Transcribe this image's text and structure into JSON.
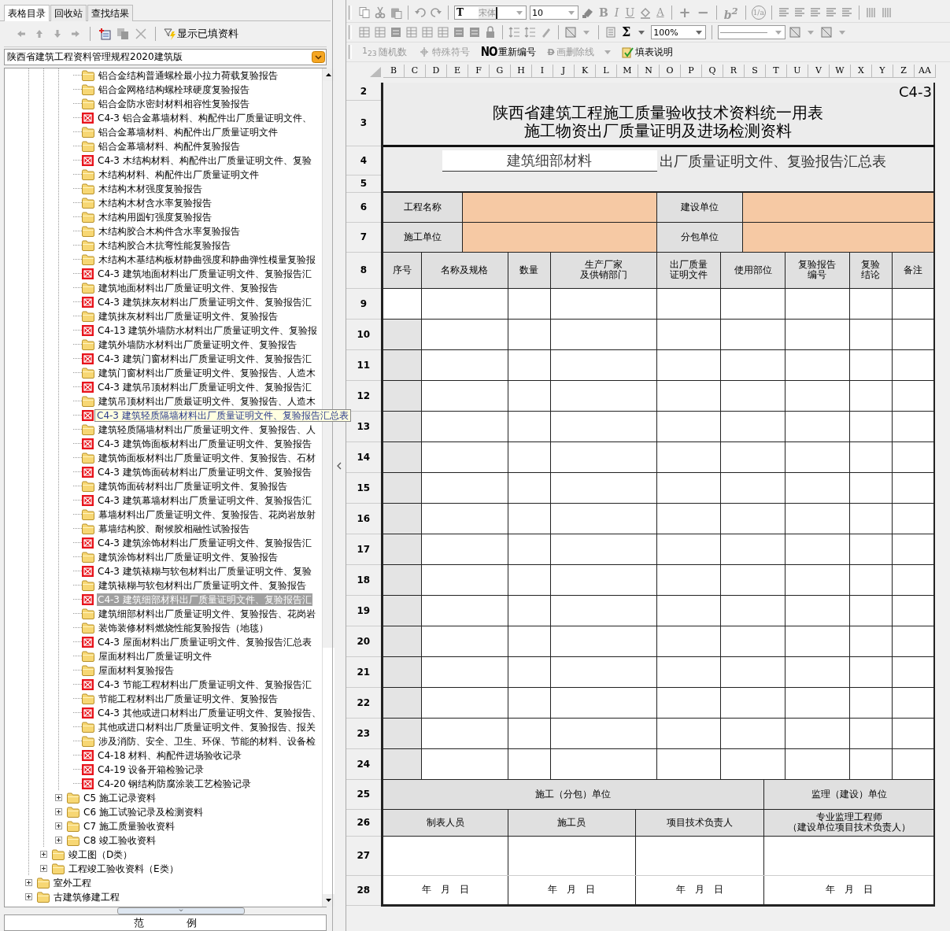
{
  "left_tabs": [
    {
      "label": "表格目录",
      "selected": true
    },
    {
      "label": "回收站",
      "selected": false
    },
    {
      "label": "查找结果",
      "selected": false
    }
  ],
  "left_toolbar": {
    "show_filled_button": "显示已填资料"
  },
  "spec_select": {
    "value": "陕西省建筑工程资料管理规程2020建筑版"
  },
  "tree": [
    {
      "children": [
        {
          "children": [
            {
              "children": [
                {
                  "label": "铝合金结构普通螺栓最小拉力荷载复验报告",
                  "kind": "folder",
                  "selected": false
                },
                {
                  "label": "铝合金网格结构螺栓球硬度复验报告",
                  "kind": "folder",
                  "selected": false
                },
                {
                  "label": "铝合金防水密封材料相容性复验报告",
                  "kind": "folder",
                  "selected": false
                },
                {
                  "label": "C4-3 铝合金幕墙材料、构配件出厂质量证明文件、",
                  "kind": "form",
                  "selected": false
                },
                {
                  "label": "铝合金幕墙材料、构配件出厂质量证明文件",
                  "kind": "folder",
                  "selected": false
                },
                {
                  "label": "铝合金幕墙材料、构配件复验报告",
                  "kind": "folder",
                  "selected": false
                },
                {
                  "label": "C4-3 木结构材料、构配件出厂质量证明文件、复验",
                  "kind": "form",
                  "selected": false
                },
                {
                  "label": "木结构材料、构配件出厂质量证明文件",
                  "kind": "folder",
                  "selected": false
                },
                {
                  "label": "木结构木材强度复验报告",
                  "kind": "folder",
                  "selected": false
                },
                {
                  "label": "木结构木材含水率复验报告",
                  "kind": "folder",
                  "selected": false
                },
                {
                  "label": "木结构用圆钉强度复验报告",
                  "kind": "folder",
                  "selected": false
                },
                {
                  "label": "木结构胶合木构件含水率复验报告",
                  "kind": "folder",
                  "selected": false
                },
                {
                  "label": "木结构胶合木抗弯性能复验报告",
                  "kind": "folder",
                  "selected": false
                },
                {
                  "label": "木结构木基结构板材静曲强度和静曲弹性模量复验报",
                  "kind": "folder",
                  "selected": false
                },
                {
                  "label": "C4-3 建筑地面材料出厂质量证明文件、复验报告汇",
                  "kind": "form",
                  "selected": false
                },
                {
                  "label": "建筑地面材料出厂质量证明文件、复验报告",
                  "kind": "folder",
                  "selected": false
                },
                {
                  "label": "C4-3 建筑抹灰材料出厂质量证明文件、复验报告汇",
                  "kind": "form",
                  "selected": false
                },
                {
                  "label": "建筑抹灰材料出厂质量证明文件、复验报告",
                  "kind": "folder",
                  "selected": false
                },
                {
                  "label": "C4-13 建筑外墙防水材料出厂质量证明文件、复验报",
                  "kind": "form",
                  "selected": false
                },
                {
                  "label": "建筑外墙防水材料出厂质量证明文件、复验报告",
                  "kind": "folder",
                  "selected": false
                },
                {
                  "label": "C4-3 建筑门窗材料出厂质量证明文件、复验报告汇",
                  "kind": "form",
                  "selected": false
                },
                {
                  "label": "建筑门窗材料出厂质量证明文件、复验报告、人造木",
                  "kind": "folder",
                  "selected": false
                },
                {
                  "label": "C4-3 建筑吊顶材料出厂质量证明文件、复验报告汇",
                  "kind": "form",
                  "selected": false
                },
                {
                  "label": "建筑吊顶材料出厂质最证明文件、复验报告、人造木",
                  "kind": "folder",
                  "selected": false
                },
                {
                  "kind": "form",
                  "selected": false,
                  "tooltip": "C4-3 建筑轻质隔墙材料出厂质量证明文件、复验报告汇总表"
                },
                {
                  "label": "建筑轻质隔墙材料出厂质量证明文件、复验报告、人",
                  "kind": "folder",
                  "selected": false
                },
                {
                  "label": "C4-3 建筑饰面板材料出厂质量证明文件、复验报告",
                  "kind": "form",
                  "selected": false
                },
                {
                  "label": "建筑饰面板材料出厂质量证明文件、复验报告、石材",
                  "kind": "folder",
                  "selected": false
                },
                {
                  "label": "C4-3 建筑饰面砖材料出厂质量证明文件、复验报告",
                  "kind": "form",
                  "selected": false
                },
                {
                  "label": "建筑饰面砖材料出厂质量证明文件、复验报告",
                  "kind": "folder",
                  "selected": false
                },
                {
                  "label": "C4-3 建筑幕墙材料出厂质量证明文件、复验报告汇",
                  "kind": "form",
                  "selected": false
                },
                {
                  "label": "幕墙材料出厂质量证明文件、复验报告、花岗岩放射",
                  "kind": "folder",
                  "selected": false
                },
                {
                  "label": "幕墙结构胶、耐候胶相融性试验报告",
                  "kind": "folder",
                  "selected": false
                },
                {
                  "label": "C4-3 建筑涂饰材料出厂质量证明文件、复验报告汇",
                  "kind": "form",
                  "selected": false
                },
                {
                  "label": "建筑涂饰材料出厂质量证明文件、复验报告",
                  "kind": "folder",
                  "selected": false
                },
                {
                  "label": "C4-3 建筑裱糊与软包材料出厂质量证明文件、复验",
                  "kind": "form",
                  "selected": false
                },
                {
                  "label": "建筑裱糊与软包材料出厂质量证明文件、复验报告",
                  "kind": "folder",
                  "selected": false
                },
                {
                  "label": "C4-3 建筑细部材料出厂质量证明文件、复验报告汇",
                  "kind": "form",
                  "selected": true
                },
                {
                  "label": "建筑细部材料出厂质量证明文件、复验报告、花岗岩",
                  "kind": "folder",
                  "selected": false
                },
                {
                  "label": "装饰装修材料燃烧性能复验报告（地毯）",
                  "kind": "folder",
                  "selected": false
                },
                {
                  "label": "C4-3 屋面材料出厂质量证明文件、复验报告汇总表",
                  "kind": "form",
                  "selected": false
                },
                {
                  "label": "屋面材料出厂质量证明文件",
                  "kind": "folder",
                  "selected": false
                },
                {
                  "label": "屋面材料复验报告",
                  "kind": "folder",
                  "selected": false
                },
                {
                  "label": "C4-3 节能工程材料出厂质量证明文件、复验报告汇",
                  "kind": "form",
                  "selected": false
                },
                {
                  "label": "节能工程材料出厂质量证明文件、复验报告",
                  "kind": "folder",
                  "selected": false
                },
                {
                  "label": "C4-3 其他或进口材料出厂质量证明文件、复验报告、",
                  "kind": "form",
                  "selected": false
                },
                {
                  "label": "其他或进口材料出厂质量证明文件、复验报告、报关",
                  "kind": "folder",
                  "selected": false
                },
                {
                  "label": "涉及消防、安全、卫生、环保、节能的材料、设备检",
                  "kind": "folder",
                  "selected": false
                },
                {
                  "label": "C4-18 材料、构配件进场验收记录",
                  "kind": "form",
                  "selected": false
                },
                {
                  "label": "C4-19 设备开箱检验记录",
                  "kind": "form",
                  "selected": false
                },
                {
                  "label": "C4-20 钢结构防腐涂装工艺检验记录",
                  "kind": "form",
                  "selected": false
                }
              ]
            },
            {
              "label": "C5 施工记录资料",
              "kind": "folder",
              "selected": false,
              "expanded": false
            },
            {
              "label": "C6 施工试验记录及检测资料",
              "kind": "folder",
              "selected": false,
              "expanded": false
            },
            {
              "label": "C7 施工质量验收资料",
              "kind": "folder",
              "selected": false,
              "expanded": false
            },
            {
              "label": "C8 竣工验收资料",
              "kind": "folder",
              "selected": false,
              "expanded": false
            }
          ]
        },
        {
          "label": "竣工图（D类）",
          "kind": "folder",
          "selected": false,
          "expanded": false
        },
        {
          "label": "工程竣工验收资料（E类）",
          "kind": "folder",
          "selected": false,
          "expanded": false
        }
      ]
    },
    {
      "label": "室外工程",
      "kind": "folder",
      "selected": false,
      "expanded": false
    },
    {
      "label": "古建筑修建工程",
      "kind": "folder",
      "selected": false,
      "expanded": false
    }
  ],
  "legend_title": "范 例",
  "format_toolbar": {
    "font_icon": "T",
    "font": "宋体",
    "font_size": "10",
    "bold": "B",
    "italic": "I",
    "underline": "U",
    "font_color": "A",
    "increase": "+",
    "decrease": "−",
    "superscript": "b$^{2}$",
    "fraction": "1/a"
  },
  "edit_toolbar": {
    "sum": "Σ",
    "zoom": "100%"
  },
  "tool_buttons": [
    {
      "icon_text": "1$_{2}$$_{3}$",
      "label": "随机数",
      "disabled": true
    },
    {
      "label": "特殊符号",
      "disabled": true
    },
    {
      "icon_text": "NO",
      "label": "重新编号",
      "disabled": false
    },
    {
      "icon_text": "D",
      "label": "画删除线",
      "disabled": true
    },
    {
      "label": "填表说明",
      "disabled": false
    }
  ],
  "sheet": {
    "columns": [
      "B",
      "C",
      "D",
      "E",
      "F",
      "G",
      "H",
      "I",
      "J",
      "K",
      "L",
      "M",
      "N",
      "O",
      "P",
      "Q",
      "R",
      "S",
      "T",
      "U",
      "V",
      "W",
      "X",
      "Y",
      "Z",
      "AA"
    ],
    "row_numbers": [
      "2",
      "3",
      "4",
      "5",
      "6",
      "7",
      "8",
      "9",
      "10",
      "11",
      "12",
      "13",
      "14",
      "15",
      "16",
      "17",
      "18",
      "19",
      "20",
      "21",
      "22",
      "23",
      "24",
      "25",
      "26",
      "27",
      "28"
    ],
    "form_code": "C4-3",
    "title_lines": [
      "陕西省建筑工程施工质量验收技术资料统一用表",
      "施工物资出厂质量证明及进场检测资料"
    ],
    "material_field": {
      "value": "建筑细部材料"
    },
    "subtitle": "出厂质量证明文件、复验报告汇总表",
    "info_fields": [
      {
        "label": "工程名称"
      },
      {
        "label": "建设单位"
      },
      {
        "label": "施工单位"
      },
      {
        "label": "分包单位"
      }
    ],
    "headers": [
      [
        "序号"
      ],
      [
        "名称及规格"
      ],
      [
        "数量"
      ],
      [
        "生产厂家",
        "及供销部门"
      ],
      [
        "出厂质量",
        "证明文件"
      ],
      [
        "使用部位"
      ],
      [
        "复验报告",
        "编号"
      ],
      [
        "复验",
        "结论"
      ],
      [
        "备注"
      ]
    ],
    "data_rows": [
      {
        "shaded": false
      },
      {
        "shaded": true
      },
      {
        "shaded": true
      },
      {
        "shaded": true
      },
      {
        "shaded": true
      },
      {
        "shaded": true
      },
      {
        "shaded": true
      },
      {
        "shaded": true
      },
      {
        "shaded": true
      },
      {
        "shaded": true
      },
      {
        "shaded": true
      },
      {
        "shaded": true
      },
      {
        "shaded": true
      },
      {
        "shaded": true
      },
      {
        "shaded": true
      },
      {
        "shaded": true
      }
    ],
    "sign_groups": [
      "施工（分包）单位",
      "监理（建设）单位"
    ],
    "sign_roles": [
      [
        "制表人员"
      ],
      [
        "施工员"
      ],
      [
        "项目技术负责人"
      ],
      [
        "专业监理工程师",
        "（建设单位项目技术负责人）"
      ]
    ],
    "date_texts": [
      "年　月　日",
      "年　月　日",
      "年　月　日",
      "年　月　日"
    ]
  }
}
